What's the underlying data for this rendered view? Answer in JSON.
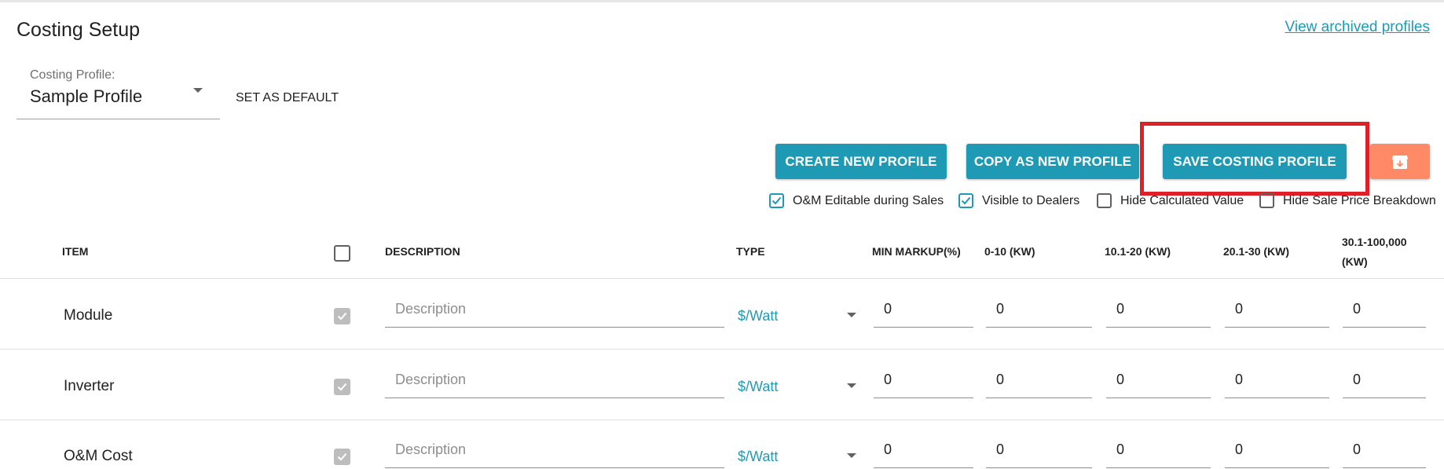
{
  "header": {
    "title": "Costing Setup",
    "archived_link": "View archived profiles"
  },
  "profile": {
    "label": "Costing Profile:",
    "value": "Sample Profile",
    "set_default": "SET AS DEFAULT"
  },
  "actions": {
    "create": "CREATE NEW PROFILE",
    "copy": "COPY AS NEW PROFILE",
    "save": "SAVE COSTING PROFILE",
    "archive_icon": "archive-icon"
  },
  "options": [
    {
      "label": "O&M Editable during Sales",
      "checked": true
    },
    {
      "label": "Visible to Dealers",
      "checked": true
    },
    {
      "label": "Hide Calculated Value",
      "checked": false
    },
    {
      "label": "Hide Sale Price Breakdown",
      "checked": false
    }
  ],
  "table": {
    "headers": {
      "item": "ITEM",
      "description": "DESCRIPTION",
      "type": "TYPE",
      "min_markup": "MIN MARKUP(%)",
      "t1": "0-10 (KW)",
      "t2": "10.1-20 (KW)",
      "t3": "20.1-30 (KW)",
      "t4_line1": "30.1-100,000",
      "t4_line2": "(KW)"
    },
    "rows": [
      {
        "item": "Module",
        "description_placeholder": "Description",
        "type": "$/Watt",
        "min_markup": "0",
        "t1": "0",
        "t2": "0",
        "t3": "0",
        "t4": "0"
      },
      {
        "item": "Inverter",
        "description_placeholder": "Description",
        "type": "$/Watt",
        "min_markup": "0",
        "t1": "0",
        "t2": "0",
        "t3": "0",
        "t4": "0"
      },
      {
        "item": "O&M Cost",
        "description_placeholder": "Description",
        "type": "$/Watt",
        "min_markup": "0",
        "t1": "0",
        "t2": "0",
        "t3": "0",
        "t4": "0"
      }
    ]
  },
  "colors": {
    "accent": "#1e9ab5",
    "archive": "#ff8a65",
    "highlight": "#e02027"
  }
}
